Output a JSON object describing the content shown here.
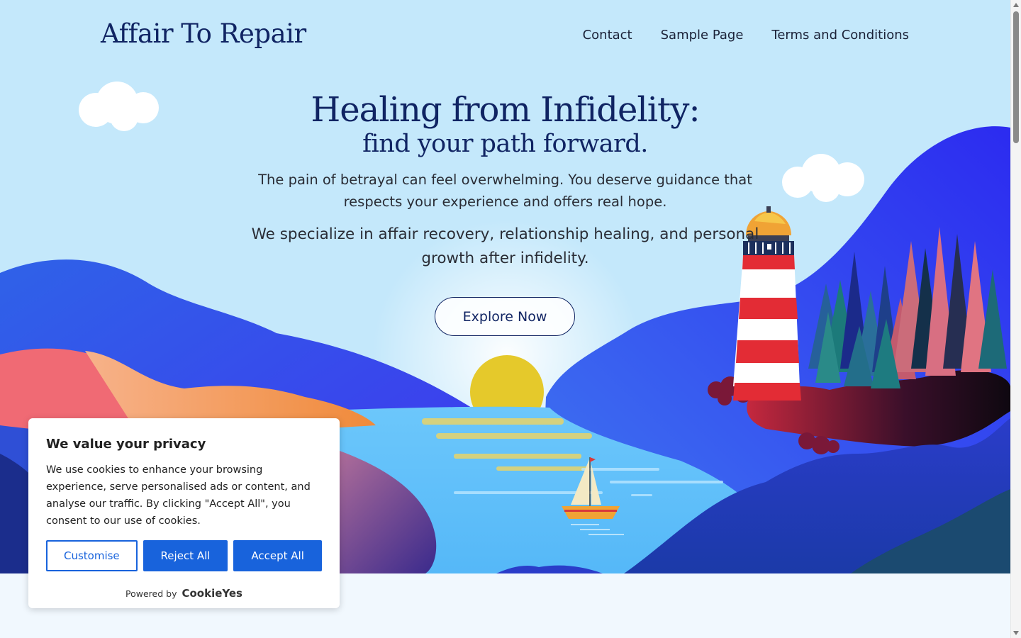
{
  "site": {
    "logo": "Affair To Repair"
  },
  "nav": {
    "items": [
      {
        "label": "Contact"
      },
      {
        "label": "Sample Page"
      },
      {
        "label": "Terms and Conditions"
      }
    ]
  },
  "hero": {
    "title": "Healing from Infidelity:",
    "subtitle": "find your path forward.",
    "paragraph1": "The pain of betrayal can feel overwhelming. You deserve guidance that respects your experience and offers real hope.",
    "paragraph2": "We specialize in affair recovery, relationship healing, and personal growth after infidelity.",
    "cta_label": "Explore Now"
  },
  "cookie_banner": {
    "title": "We value your privacy",
    "text": "We use cookies to enhance your browsing experience, serve personalised ads or content, and analyse our traffic. By clicking \"Accept All\", you consent to our use of cookies.",
    "customise_label": "Customise",
    "reject_label": "Reject All",
    "accept_label": "Accept All",
    "powered_by": "Powered by",
    "powered_brand": "CookieYes"
  },
  "colors": {
    "sky": "#c4e8fb",
    "navy": "#102463",
    "primary_button": "#1863dc",
    "sun": "#e5c92b",
    "lighthouse_red": "#e32c35"
  },
  "icons": {
    "scroll_up": "scroll-up-arrow-icon",
    "scroll_down": "scroll-down-arrow-icon"
  }
}
